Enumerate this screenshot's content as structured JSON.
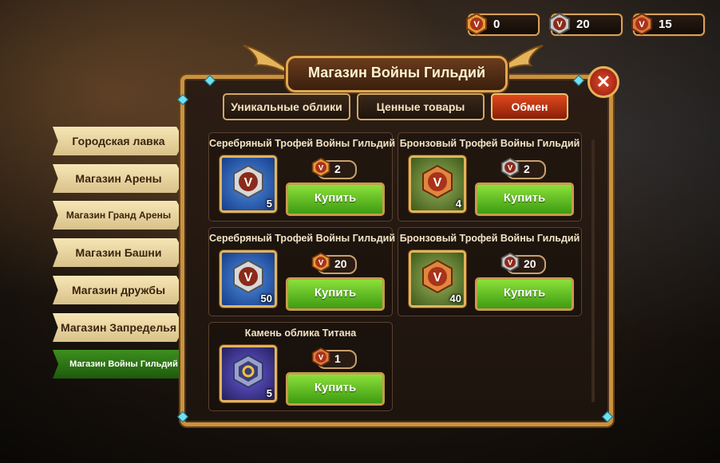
{
  "currencies": [
    {
      "type": "gold-trophy",
      "amount": "0",
      "color": "#e89a3a"
    },
    {
      "type": "silver-trophy",
      "amount": "20",
      "color": "#b8b8b8"
    },
    {
      "type": "bronze-trophy",
      "amount": "15",
      "color": "#e07a3a"
    }
  ],
  "shop": {
    "title": "Магазин Войны Гильдий",
    "tabs": [
      {
        "label": "Уникальные облики",
        "active": false
      },
      {
        "label": "Ценные товары",
        "active": false
      },
      {
        "label": "Обмен",
        "active": true
      }
    ]
  },
  "sidebar": {
    "items": [
      {
        "label": "Городская лавка"
      },
      {
        "label": "Магазин Арены"
      },
      {
        "label": "Магазин Гранд Арены"
      },
      {
        "label": "Магазин Башни"
      },
      {
        "label": "Магазин дружбы"
      },
      {
        "label": "Магазин Запределья"
      },
      {
        "label": "Магазин Войны Гильдий",
        "active": true
      }
    ]
  },
  "items": [
    {
      "title": "Серебряный Трофей Войны Гильдий",
      "qty": "5",
      "price": "2",
      "price_icon": "gold-trophy",
      "icon": "silver-trophy",
      "buy": "Купить"
    },
    {
      "title": "Бронзовый Трофей Войны Гильдий",
      "qty": "4",
      "price": "2",
      "price_icon": "silver-trophy",
      "icon": "bronze-trophy",
      "buy": "Купить"
    },
    {
      "title": "Серебряный Трофей Войны Гильдий",
      "qty": "50",
      "price": "20",
      "price_icon": "gold-trophy",
      "icon": "silver-trophy",
      "buy": "Купить"
    },
    {
      "title": "Бронзовый Трофей Войны Гильдий",
      "qty": "40",
      "price": "20",
      "price_icon": "silver-trophy",
      "icon": "bronze-trophy",
      "buy": "Купить"
    },
    {
      "title": "Камень облика Титана",
      "qty": "5",
      "price": "1",
      "price_icon": "bronze-trophy",
      "icon": "titan-skin-stone",
      "buy": "Купить"
    }
  ],
  "close_icon": "close-icon"
}
